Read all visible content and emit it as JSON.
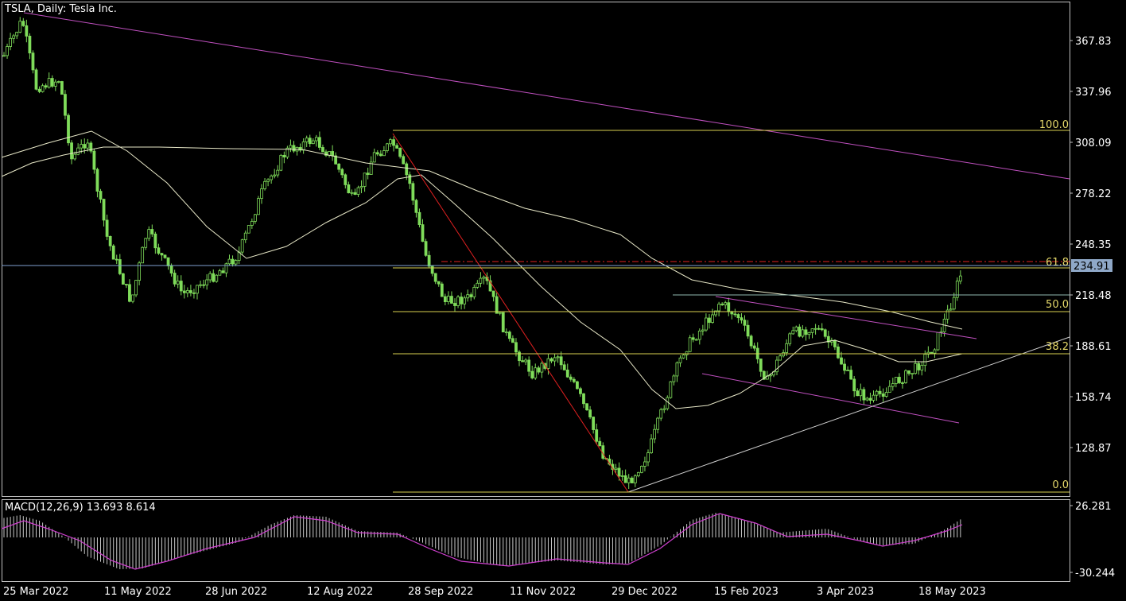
{
  "header": {
    "title": "TSLA, Daily:  Tesla Inc.",
    "macd_title": "MACD(12,26,9) 13.693 8.614"
  },
  "colors": {
    "background": "#000000",
    "candle": "#7fdc5a",
    "axis": "#c0c0c0",
    "ma_line": "#e8e8c8",
    "trendline": "#c050c0",
    "fib": "#d8d050",
    "fib_label": "#e6d96a",
    "impulse": "#e02020",
    "current_price": "#7f9fcf",
    "macd_signal": "#d040d0",
    "macd_hist": "#c8c8c8"
  },
  "price_axis": {
    "labels": [
      "367.83",
      "337.96",
      "308.09",
      "278.22",
      "248.35",
      "218.48",
      "188.61",
      "158.74",
      "128.87"
    ],
    "current_price": "234.91",
    "current_price_value": 234.91
  },
  "macd_axis": {
    "labels": [
      "26.281",
      "-30.244"
    ]
  },
  "time_axis": {
    "labels": [
      "25 Mar 2022",
      "11 May 2022",
      "28 Jun 2022",
      "12 Aug 2022",
      "28 Sep 2022",
      "11 Nov 2022",
      "29 Dec 2022",
      "15 Feb 2023",
      "3 Apr 2023",
      "18 May 2023"
    ]
  },
  "fibonacci": {
    "levels": [
      "100.0",
      "61.8",
      "50.0",
      "38.2",
      "0.0"
    ],
    "high": 313.8,
    "low": 101.8
  },
  "chart_data": {
    "type": "candlestick",
    "title": "TSLA, Daily:  Tesla Inc.",
    "x_range": [
      "25 Mar 2022",
      "18 May 2023"
    ],
    "y_range": [
      101.8,
      380
    ],
    "last_close": 234.91,
    "indicator": "MACD(12,26,9) 13.693 8.614",
    "macd_range": [
      -30.244,
      26.281
    ]
  }
}
